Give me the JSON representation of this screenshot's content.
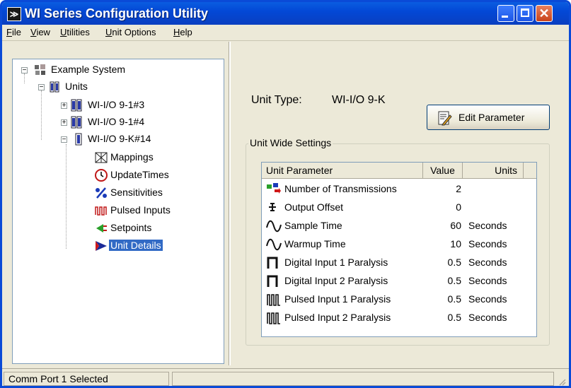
{
  "window": {
    "title": "WI Series Configuration Utility",
    "app_icon": "app-logo-icon"
  },
  "menu": [
    "File",
    "View",
    "Utilities",
    "Unit Options",
    "Help"
  ],
  "tree": {
    "root": "Example System",
    "units": "Units",
    "unit1": "WI-I/O 9-1#3",
    "unit2": "WI-I/O 9-1#4",
    "unit3": "WI-I/O 9-K#14",
    "children": [
      "Mappings",
      "UpdateTimes",
      "Sensitivities",
      "Pulsed Inputs",
      "Setpoints",
      "Unit Details"
    ],
    "selected": "Unit Details"
  },
  "details": {
    "unit_type_label": "Unit Type:",
    "unit_type_value": "WI-I/O 9-K",
    "edit_button": "Edit Parameter",
    "group_title": "Unit Wide Settings",
    "columns": [
      "Unit Parameter",
      "Value",
      "Units"
    ],
    "rows": [
      {
        "icon": "transmissions-icon",
        "name": "Number of Transmissions",
        "value": "2",
        "units": ""
      },
      {
        "icon": "offset-icon",
        "name": "Output Offset",
        "value": "0",
        "units": ""
      },
      {
        "icon": "sine-wave-icon",
        "name": "Sample Time",
        "value": "60",
        "units": "Seconds"
      },
      {
        "icon": "sine-wave-icon",
        "name": "Warmup Time",
        "value": "10",
        "units": "Seconds"
      },
      {
        "icon": "square-pulse-icon",
        "name": "Digital Input 1 Paralysis",
        "value": "0.5",
        "units": "Seconds"
      },
      {
        "icon": "square-pulse-icon",
        "name": "Digital Input 2 Paralysis",
        "value": "0.5",
        "units": "Seconds"
      },
      {
        "icon": "pulse-train-icon",
        "name": "Pulsed Input 1 Paralysis",
        "value": "0.5",
        "units": "Seconds"
      },
      {
        "icon": "pulse-train-icon",
        "name": "Pulsed Input 2 Paralysis",
        "value": "0.5",
        "units": "Seconds"
      }
    ]
  },
  "status": {
    "text": "Comm Port 1 Selected"
  },
  "colors": {
    "titlebar": "#0a5de0",
    "selection": "#316ac5",
    "window_bg": "#ece9d8"
  }
}
